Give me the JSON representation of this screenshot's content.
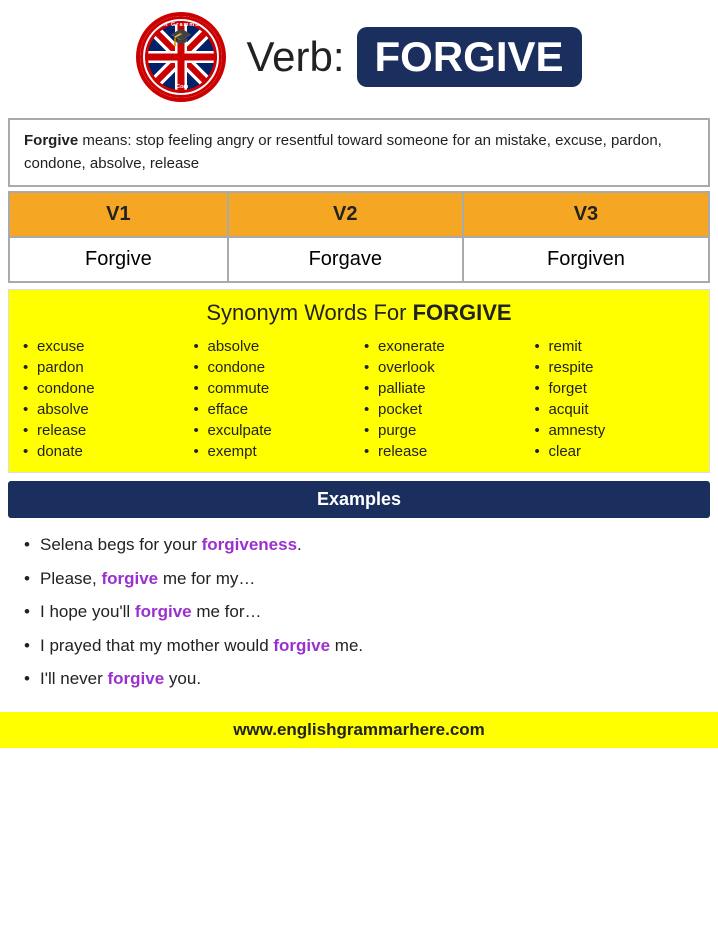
{
  "header": {
    "verb_label": "Verb:",
    "verb_word": "FORGIVE",
    "logo_alt": "English Grammar Here"
  },
  "definition": {
    "word": "Forgive",
    "text": " means: stop feeling angry or resentful toward someone for an mistake, excuse, pardon, condone, absolve, release"
  },
  "verb_forms": {
    "headers": [
      "V1",
      "V2",
      "V3"
    ],
    "values": [
      "Forgive",
      "Forgave",
      "Forgiven"
    ]
  },
  "synonyms": {
    "title": "Synonym Words For ",
    "title_bold": "FORGIVE",
    "columns": [
      [
        "excuse",
        "pardon",
        "condone",
        "absolve",
        "release",
        "donate"
      ],
      [
        "absolve",
        "condone",
        "commute",
        "efface",
        "exculpate",
        "exempt"
      ],
      [
        "exonerate",
        "overlook",
        "palliate",
        "pocket",
        "purge",
        "release"
      ],
      [
        "remit",
        "respite",
        "forget",
        "acquit",
        "amnesty",
        "clear"
      ]
    ]
  },
  "examples": {
    "header": "Examples",
    "items": [
      {
        "text": "Selena begs for your ",
        "highlight": "forgiveness",
        "suffix": "."
      },
      {
        "text": "Please, ",
        "highlight": "forgive",
        "suffix": " me for my…"
      },
      {
        "text": "I hope you'll ",
        "highlight": "forgive",
        "suffix": " me for…"
      },
      {
        "text": "I prayed that my mother would ",
        "highlight": "forgive",
        "suffix": " me."
      },
      {
        "text": "I'll never ",
        "highlight": "forgive",
        "suffix": " you."
      }
    ]
  },
  "footer": {
    "url": "www.englishgrammarhere.com"
  }
}
